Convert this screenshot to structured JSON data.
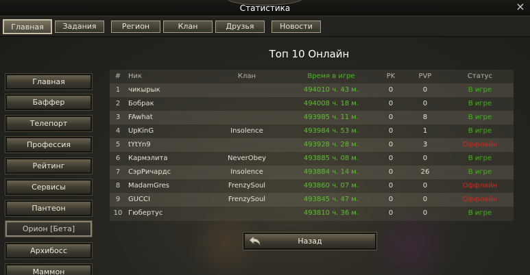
{
  "window": {
    "title": "Статистика",
    "close_label": "×"
  },
  "tabs": [
    {
      "label": "Главная",
      "active": true
    },
    {
      "label": "Задания",
      "active": false
    },
    {
      "label": "Регион",
      "active": false
    },
    {
      "label": "Клан",
      "active": false
    },
    {
      "label": "Друзья",
      "active": false
    },
    {
      "label": "Новости",
      "active": false
    }
  ],
  "sidebar": {
    "items": [
      {
        "label": "Главная"
      },
      {
        "label": "Баффер"
      },
      {
        "label": "Телепорт"
      },
      {
        "label": "Профессия"
      },
      {
        "label": "Рейтинг"
      },
      {
        "label": "Сервисы"
      },
      {
        "label": "Пантеон"
      },
      {
        "label": "Орион [Бета]",
        "selected": true
      },
      {
        "label": "Архибосс"
      },
      {
        "label": "Маммон"
      }
    ]
  },
  "main": {
    "heading": "Топ 10 Онлайн",
    "columns": {
      "num": "#",
      "nick": "Ник",
      "clan": "Клан",
      "time": "Время в игре",
      "pk": "PK",
      "pvp": "PVP",
      "status": "Статус"
    },
    "rows": [
      {
        "num": "1",
        "nick": "чикырык",
        "clan": "",
        "time": "494010 ч. 43 м.",
        "pk": "0",
        "pvp": "0",
        "status": "В игре"
      },
      {
        "num": "2",
        "nick": "Бобрак",
        "clan": "",
        "time": "494008 ч. 18 м.",
        "pk": "0",
        "pvp": "0",
        "status": "В игре"
      },
      {
        "num": "3",
        "nick": "FAwhat",
        "clan": "",
        "time": "493985 ч. 11 м.",
        "pk": "0",
        "pvp": "8",
        "status": "В игре"
      },
      {
        "num": "4",
        "nick": "UpKinG",
        "clan": "Insolence",
        "time": "493984 ч. 53 м.",
        "pk": "0",
        "pvp": "1",
        "status": "В игре"
      },
      {
        "num": "5",
        "nick": "tYtYn9",
        "clan": "",
        "time": "493928 ч. 28 м.",
        "pk": "0",
        "pvp": "3",
        "status": "Оффлайн"
      },
      {
        "num": "6",
        "nick": "Кармэлита",
        "clan": "NeverObey",
        "time": "493885 ч. 08 м.",
        "pk": "0",
        "pvp": "0",
        "status": "В игре"
      },
      {
        "num": "7",
        "nick": "СэрРичардс",
        "clan": "Insolence",
        "time": "493884 ч. 14 м.",
        "pk": "0",
        "pvp": "26",
        "status": "В игре"
      },
      {
        "num": "8",
        "nick": "MadamGres",
        "clan": "FrenzySoul",
        "time": "493860 ч. 07 м.",
        "pk": "0",
        "pvp": "0",
        "status": "Оффлайн"
      },
      {
        "num": "9",
        "nick": "GUCCI",
        "clan": "FrenzySoul",
        "time": "493845 ч. 47 м.",
        "pk": "0",
        "pvp": "0",
        "status": "Оффлайн"
      },
      {
        "num": "10",
        "nick": "Гюбертус",
        "clan": "",
        "time": "493810 ч. 36 м.",
        "pk": "0",
        "pvp": "0",
        "status": "В игре"
      }
    ],
    "back_label": "Назад"
  },
  "colors": {
    "online": "#43b31f",
    "offline": "#d8261d",
    "time": "#59c22c"
  }
}
